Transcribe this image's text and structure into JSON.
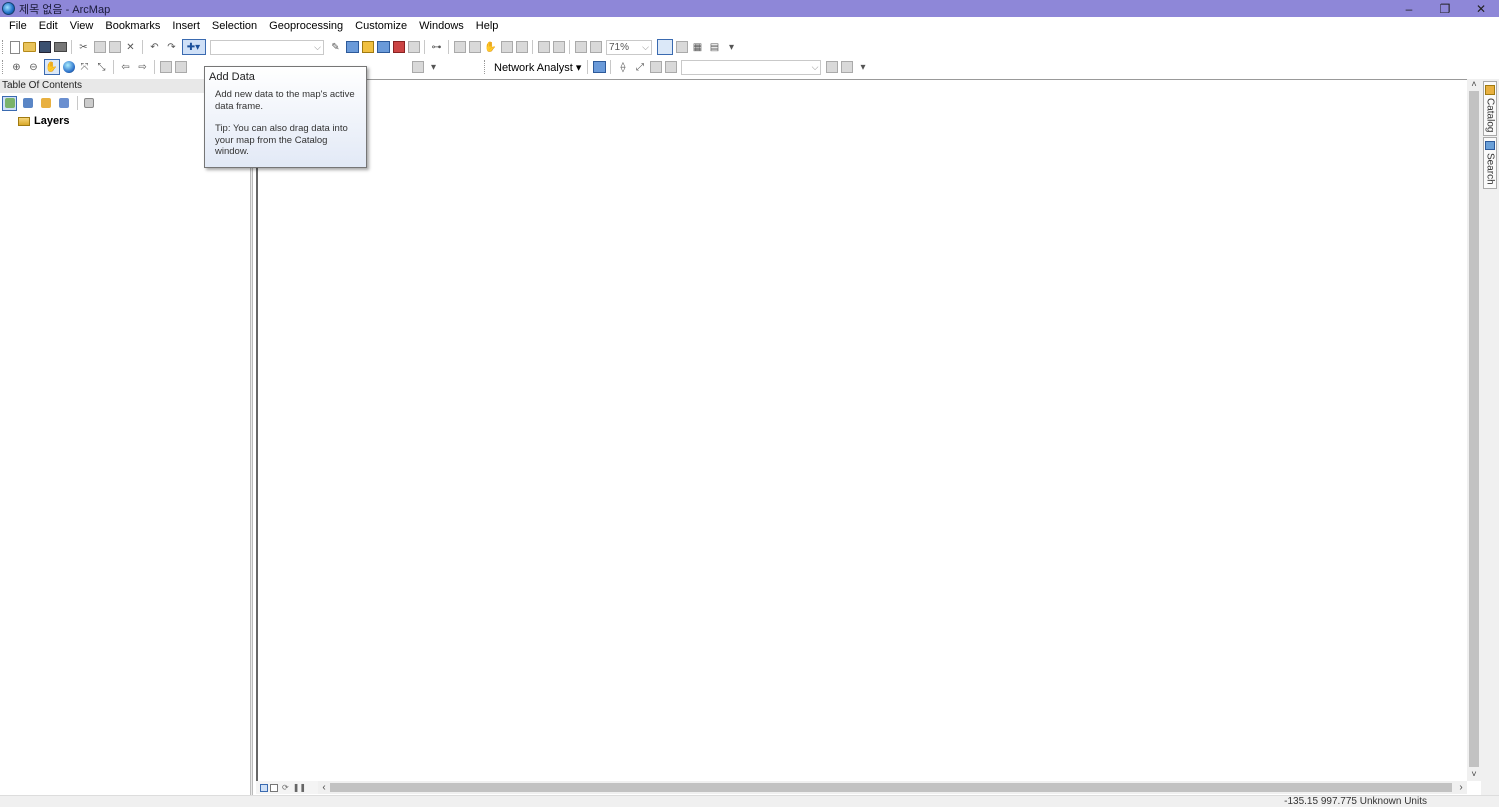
{
  "window": {
    "title": "제목 없음 - ArcMap",
    "minimize": "–",
    "restore": "❐",
    "close": "✕"
  },
  "menu": [
    "File",
    "Edit",
    "View",
    "Bookmarks",
    "Insert",
    "Selection",
    "Geoprocessing",
    "Customize",
    "Windows",
    "Help"
  ],
  "toolbar": {
    "zoom_level": "71%",
    "network_analyst_label": "Network Analyst ▾"
  },
  "toc": {
    "title": "Table Of Contents",
    "root_layer": "Layers"
  },
  "dock": {
    "catalog_tab": "Catalog",
    "search_tab": "Search"
  },
  "tooltip": {
    "title": "Add Data",
    "body": "Add new data to the map's active data frame.",
    "tip": "Tip: You can also drag data into your map from the Catalog window."
  },
  "status": {
    "coordinates": "-135.15  997.775 Unknown Units"
  },
  "colors": {
    "titlebar": "#8e87d8",
    "selection_blue": "#3a6ab0"
  }
}
